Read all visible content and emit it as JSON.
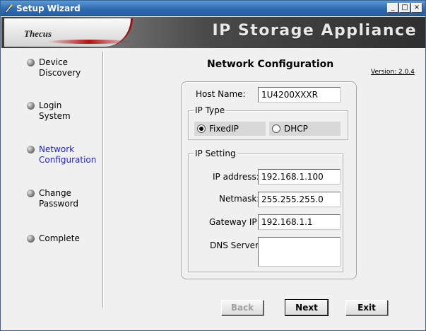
{
  "window": {
    "title": "Setup Wizard",
    "controls": {
      "minimize": "_",
      "maximize": "□",
      "close": "×"
    }
  },
  "banner": {
    "logo_text": "Thecus",
    "title": "IP Storage Appliance"
  },
  "sidebar": {
    "steps": [
      {
        "line1": "Device",
        "line2": "Discovery",
        "active": false
      },
      {
        "line1": "Login",
        "line2": "System",
        "active": false
      },
      {
        "line1": "Network",
        "line2": "Configuration",
        "active": true
      },
      {
        "line1": "Change",
        "line2": "Password",
        "active": false
      },
      {
        "line1": "Complete",
        "line2": "",
        "active": false
      }
    ]
  },
  "main": {
    "title": "Network Configuration",
    "version": "Version: 2.0.4",
    "host_name": {
      "label": "Host Name:",
      "value": "1U4200XXXR"
    },
    "ip_type": {
      "legend": "IP Type",
      "fixed_label": "FixedIP",
      "dhcp_label": "DHCP",
      "selected": "FixedIP"
    },
    "ip_setting": {
      "legend": "IP Setting",
      "ip_address": {
        "label": "IP address:",
        "value": "192.168.1.100"
      },
      "netmask": {
        "label": "Netmask:",
        "value": "255.255.255.0"
      },
      "gateway": {
        "label": "Gateway IP:",
        "value": "192.168.1.1"
      },
      "dns": {
        "label": "DNS Server:",
        "value": ""
      }
    }
  },
  "buttons": {
    "back": "Back",
    "next": "Next",
    "exit": "Exit"
  },
  "colors": {
    "accent": "#1f1fd0",
    "titlebar": "#2e6bb0",
    "banner_red": "#9a1010"
  }
}
